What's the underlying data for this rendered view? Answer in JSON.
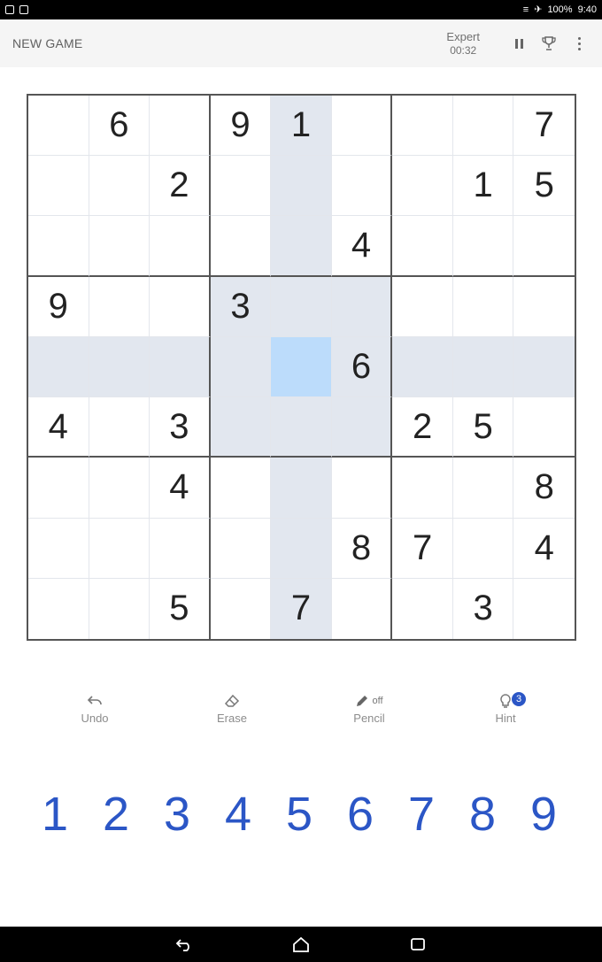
{
  "status_bar": {
    "time": "9:40",
    "battery": "100%"
  },
  "header": {
    "new_game_label": "NEW GAME",
    "difficulty": "Expert",
    "timer": "00:32"
  },
  "board": {
    "rows": [
      [
        "",
        "6",
        "",
        "9",
        "1",
        "",
        "",
        "",
        "7"
      ],
      [
        "",
        "",
        "2",
        "",
        "",
        "",
        "",
        "1",
        "5"
      ],
      [
        "",
        "",
        "",
        "",
        "",
        "4",
        "",
        "",
        ""
      ],
      [
        "9",
        "",
        "",
        "3",
        "",
        "",
        "",
        "",
        ""
      ],
      [
        "",
        "",
        "",
        "",
        "",
        "6",
        "",
        "",
        ""
      ],
      [
        "4",
        "",
        "3",
        "",
        "",
        "",
        "2",
        "5",
        ""
      ],
      [
        "",
        "",
        "4",
        "",
        "",
        "",
        "",
        "",
        "8"
      ],
      [
        "",
        "",
        "",
        "",
        "",
        "8",
        "7",
        "",
        "4"
      ],
      [
        "",
        "",
        "5",
        "",
        "7",
        "",
        "",
        "3",
        ""
      ]
    ],
    "selected_cell": {
      "row": 4,
      "col": 4
    }
  },
  "actions": {
    "undo_label": "Undo",
    "erase_label": "Erase",
    "pencil_label": "Pencil",
    "pencil_state": "off",
    "hint_label": "Hint",
    "hint_count": "3"
  },
  "numpad": [
    "1",
    "2",
    "3",
    "4",
    "5",
    "6",
    "7",
    "8",
    "9"
  ],
  "colors": {
    "accent": "#2b56c6",
    "selected": "#bcdcfb",
    "highlight": "#e2e7ef",
    "same_number": "#c4ccdb"
  }
}
